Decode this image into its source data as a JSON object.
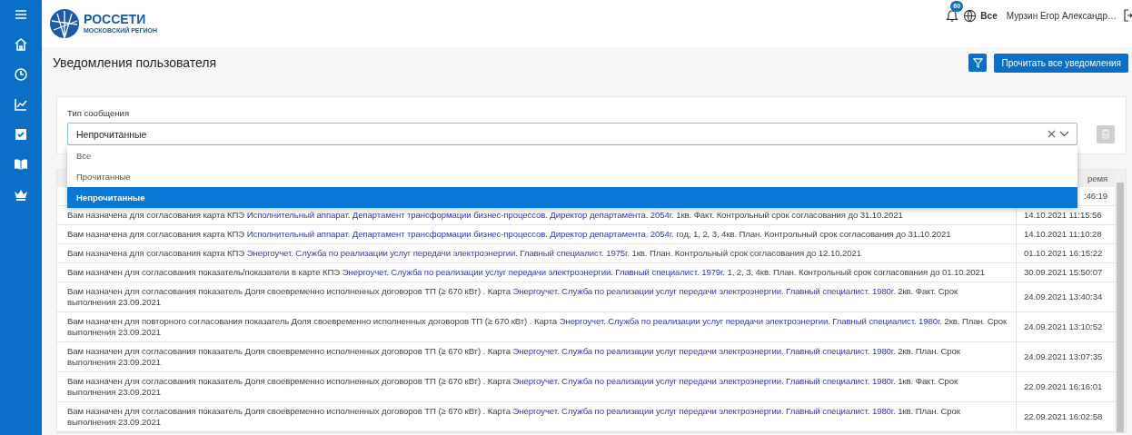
{
  "header": {
    "logo": {
      "title": "РОССЕТИ",
      "subtitle": "МОСКОВСКИЙ РЕГИОН"
    },
    "notifications_badge": "60",
    "scope": "Все",
    "user": "Мурзин Егор Александр…"
  },
  "page": {
    "title": "Уведомления пользователя",
    "read_all_button": "Прочитать все уведомления"
  },
  "filter": {
    "label": "Тип сообщения",
    "value": "Непрочитанные",
    "expanded": true,
    "delete_disabled": true,
    "options": [
      {
        "label": "Все",
        "selected": false
      },
      {
        "label": "Прочитанные",
        "selected": false
      },
      {
        "label": "Непрочитанные",
        "selected": true
      }
    ]
  },
  "table": {
    "time_header": "ремя",
    "rows": [
      {
        "time": ":46:19"
      },
      {
        "text_before": "Вам назначена для согласования карта КПЭ ",
        "link": "Исполнительный аппарат. Департамент трансформации бизнес-процессов. Директор департамента. 2054г.",
        "text_after": " 1кв. Факт. Контрольный срок согласования до 31.10.2021",
        "time": "14.10.2021 11:15:56"
      },
      {
        "text_before": "Вам назначена для согласования карта КПЭ ",
        "link": "Исполнительный аппарат. Департамент трансформации бизнес-процессов. Директор департамента. 2054г.",
        "text_after": " год, 1, 2, 3, 4кв. План. Контрольный срок согласования до 31.10.2021",
        "time": "14.10.2021 11:10:28"
      },
      {
        "text_before": "Вам назначена для согласования карта КПЭ ",
        "link": "Энергоучет. Служба по реализации услуг передачи электроэнергии. Главный специалист. 1975г.",
        "text_after": " 1кв. План. Контрольный срок согласования до 12.10.2021",
        "time": "01.10.2021 16:15:22"
      },
      {
        "text_before": "Вам назначен для согласования показатель/показатели в карте КПЭ ",
        "link": "Энергоучет. Служба по реализации услуг передачи электроэнергии. Главный специалист. 1979г.",
        "text_after": " 1, 2, 3, 4кв. План. Контрольный срок согласования до 01.10.2021",
        "time": "30.09.2021 15:50:07"
      },
      {
        "text_before": "Вам назначен для согласования показатель Доля своевременно исполненных договоров ТП (≥ 670 кВт) . Карта ",
        "link": "Энергоучет. Служба по реализации услуг передачи электроэнергии. Главный специалист. 1980г.",
        "text_after": " 2кв. Факт. Срок выполнения 23.09.2021",
        "time": "24.09.2021 13:40:34"
      },
      {
        "text_before": "Вам назначен для повторного согласования показатель Доля своевременно исполненных договоров ТП (≥ 670 кВт) . Карта ",
        "link": "Энергоучет. Служба по реализации услуг передачи электроэнергии. Главный специалист. 1980г.",
        "text_after": " 2кв. План. Срок выполнения 23.09.2021",
        "time": "24.09.2021 13:10:52"
      },
      {
        "text_before": "Вам назначен для согласования показатель Доля своевременно исполненных договоров ТП (≥ 670 кВт) . Карта ",
        "link": "Энергоучет. Служба по реализации услуг передачи электроэнергии. Главный специалист. 1980г.",
        "text_after": " 2кв. План. Срок выполнения 23.09.2021",
        "time": "24.09.2021 13:07:35"
      },
      {
        "text_before": "Вам назначен для согласования показатель Доля своевременно исполненных договоров ТП (≥ 670 кВт) . Карта ",
        "link": "Энергоучет. Служба по реализации услуг передачи электроэнергии. Главный специалист. 1980г.",
        "text_after": " 1кв. Факт. Срок выполнения 23.09.2021",
        "time": "22.09.2021 16:16:01"
      },
      {
        "text_before": "Вам назначен для согласования показатель Доля своевременно исполненных договоров ТП (≥ 670 кВт) . Карта ",
        "link": "Энергоучет. Служба по реализации услуг передачи электроэнергии. Главный специалист. 1980г.",
        "text_after": " 1кв. План. Срок выполнения 23.09.2021",
        "time": "22.09.2021 16:02:58"
      }
    ]
  }
}
